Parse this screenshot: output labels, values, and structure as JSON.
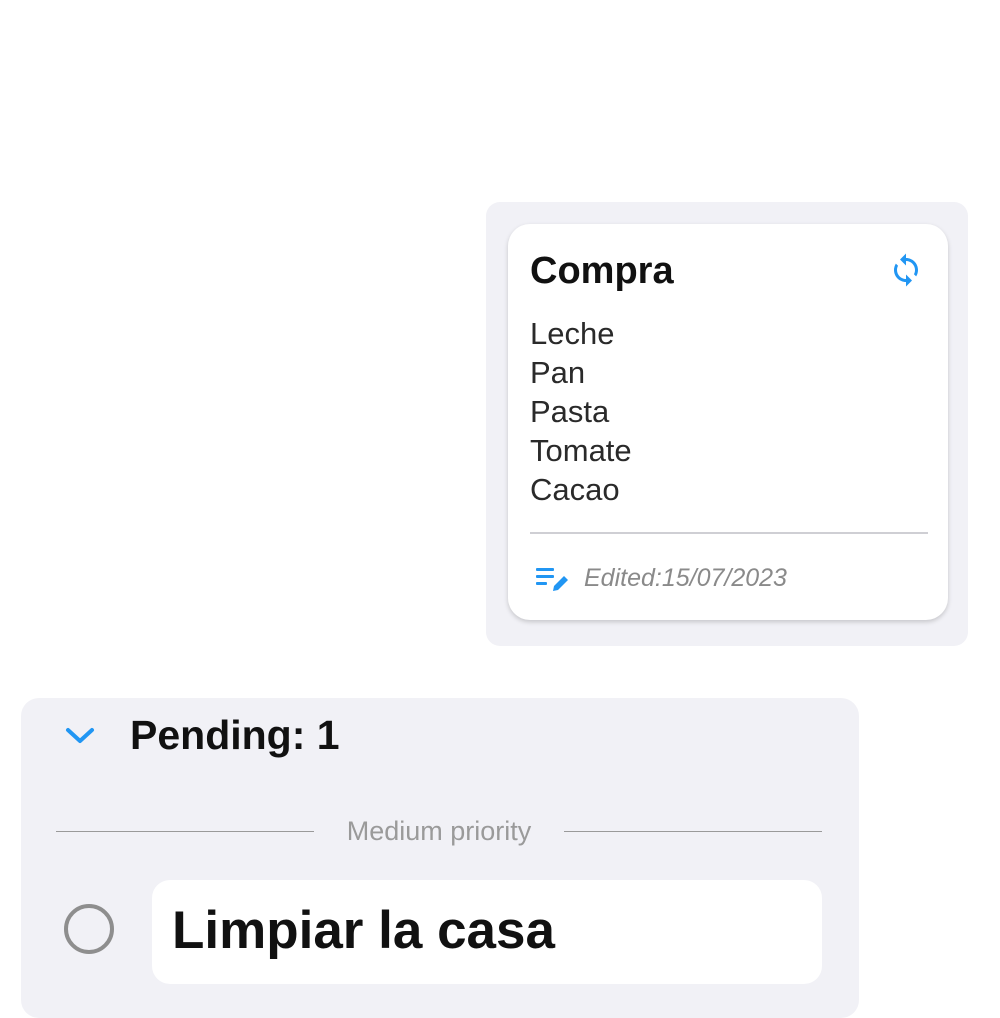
{
  "note": {
    "title": "Compra",
    "lines": [
      "Leche",
      "Pan",
      "Pasta",
      "Tomate",
      "Cacao"
    ],
    "edited": "Edited:15/07/2023",
    "icons": {
      "sync": "sync-icon",
      "edit": "edit-note-icon"
    }
  },
  "pending": {
    "title": "Pending: 1",
    "priority_label": "Medium priority",
    "icons": {
      "toggle": "chevron-down-icon",
      "checkbox": "radio-unchecked-icon"
    },
    "tasks": [
      {
        "title": "Limpiar la casa",
        "done": false
      }
    ]
  },
  "colors": {
    "accent": "#2196f3",
    "panel_bg": "#f1f1f6",
    "text_primary": "#111111",
    "text_muted": "#8a8a8a"
  }
}
